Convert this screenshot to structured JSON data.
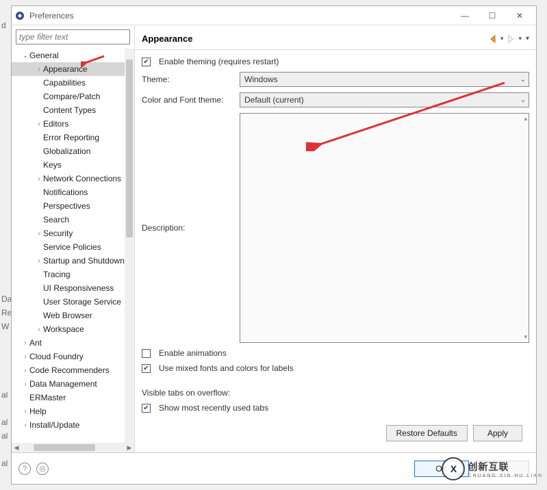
{
  "window": {
    "title": "Preferences"
  },
  "sidebar": {
    "filter_placeholder": "type filter text",
    "items": [
      {
        "label": "General",
        "indent": 0,
        "expand": "open"
      },
      {
        "label": "Appearance",
        "indent": 1,
        "expand": "closed",
        "sel": true
      },
      {
        "label": "Capabilities",
        "indent": 1
      },
      {
        "label": "Compare/Patch",
        "indent": 1
      },
      {
        "label": "Content Types",
        "indent": 1
      },
      {
        "label": "Editors",
        "indent": 1,
        "expand": "closed"
      },
      {
        "label": "Error Reporting",
        "indent": 1
      },
      {
        "label": "Globalization",
        "indent": 1
      },
      {
        "label": "Keys",
        "indent": 1
      },
      {
        "label": "Network Connections",
        "indent": 1,
        "expand": "closed"
      },
      {
        "label": "Notifications",
        "indent": 1
      },
      {
        "label": "Perspectives",
        "indent": 1
      },
      {
        "label": "Search",
        "indent": 1
      },
      {
        "label": "Security",
        "indent": 1,
        "expand": "closed"
      },
      {
        "label": "Service Policies",
        "indent": 1
      },
      {
        "label": "Startup and Shutdown",
        "indent": 1,
        "expand": "closed"
      },
      {
        "label": "Tracing",
        "indent": 1
      },
      {
        "label": "UI Responsiveness",
        "indent": 1
      },
      {
        "label": "User Storage Service",
        "indent": 1
      },
      {
        "label": "Web Browser",
        "indent": 1
      },
      {
        "label": "Workspace",
        "indent": 1,
        "expand": "closed"
      },
      {
        "label": "Ant",
        "indent": 0,
        "expand": "closed"
      },
      {
        "label": "Cloud Foundry",
        "indent": 0,
        "expand": "closed"
      },
      {
        "label": "Code Recommenders",
        "indent": 0,
        "expand": "closed"
      },
      {
        "label": "Data Management",
        "indent": 0,
        "expand": "closed"
      },
      {
        "label": "ERMaster",
        "indent": 0
      },
      {
        "label": "Help",
        "indent": 0,
        "expand": "closed"
      },
      {
        "label": "Install/Update",
        "indent": 0,
        "expand": "closed"
      }
    ]
  },
  "page": {
    "title": "Appearance",
    "enable_theming": "Enable theming (requires restart)",
    "theme_label": "Theme:",
    "theme_value": "Windows",
    "colorfont_label": "Color and Font theme:",
    "colorfont_value": "Default (current)",
    "description_label": "Description:",
    "enable_animations": "Enable animations",
    "use_mixed_fonts": "Use mixed fonts and colors for labels",
    "visible_tabs_label": "Visible tabs on overflow:",
    "show_mru": "Show most recently used tabs",
    "restore_defaults": "Restore Defaults",
    "apply": "Apply",
    "ok": "OK",
    "cancel": "Cancel"
  },
  "watermark": {
    "logo": "X",
    "main": "创新互联",
    "sub": "CHUANG XIN HU LIAN"
  },
  "left_bleed": [
    "d",
    "",
    "",
    "",
    "",
    "",
    "",
    "",
    "",
    "",
    "",
    "",
    "",
    "",
    "",
    "",
    "",
    "",
    "",
    "",
    "Da",
    "Re",
    "W",
    "",
    "",
    "",
    "",
    "al",
    "",
    "al",
    "al",
    "",
    "al"
  ]
}
